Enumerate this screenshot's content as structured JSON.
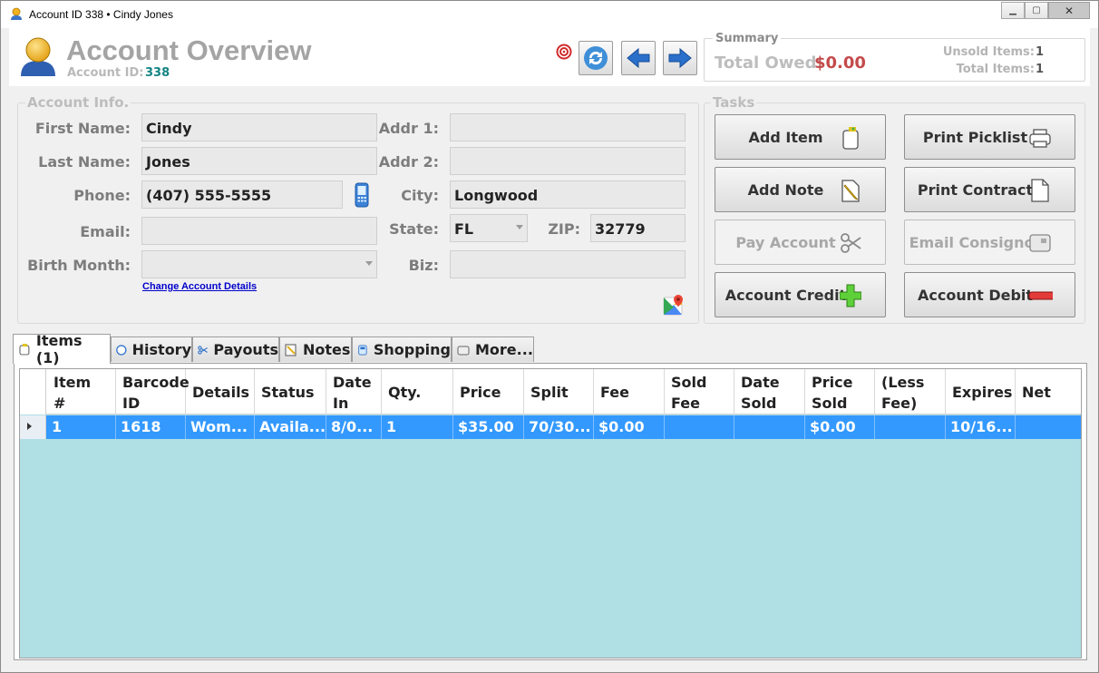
{
  "window": {
    "title": "Account ID 338 • Cindy Jones"
  },
  "header": {
    "title": "Account Overview",
    "account_id_label": "Account ID:",
    "account_id": "338"
  },
  "summary": {
    "legend": "Summary",
    "total_owed_label": "Total Owed:",
    "total_owed": "$0.00",
    "unsold_label": "Unsold Items:",
    "unsold": "1",
    "total_items_label": "Total Items:",
    "total_items": "1"
  },
  "account_info": {
    "legend": "Account Info.",
    "first_name_label": "First Name:",
    "first_name": "Cindy",
    "last_name_label": "Last Name:",
    "last_name": "Jones",
    "phone_label": "Phone:",
    "phone": "(407) 555-5555",
    "email_label": "Email:",
    "email": "",
    "birth_month_label": "Birth Month:",
    "birth_month": "",
    "addr1_label": "Addr 1:",
    "addr1": "",
    "addr2_label": "Addr 2:",
    "addr2": "",
    "city_label": "City:",
    "city": "Longwood",
    "state_label": "State:",
    "state": "FL",
    "zip_label": "ZIP:",
    "zip": "32779",
    "biz_label": "Biz:",
    "biz": "",
    "change_link": "Change Account Details"
  },
  "tasks": {
    "legend": "Tasks",
    "add_item": "Add Item",
    "print_picklist": "Print Picklist",
    "add_note": "Add Note",
    "print_contract": "Print Contract",
    "pay_account": "Pay Account",
    "email_consignor": "Email Consignor",
    "account_credit": "Account Credit",
    "account_debit": "Account Debit"
  },
  "tabs": [
    "Items (1)",
    "History",
    "Payouts",
    "Notes",
    "Shopping",
    "More..."
  ],
  "table": {
    "headers": [
      [
        "Item",
        "#"
      ],
      [
        "Barcode",
        "ID"
      ],
      [
        "Details",
        ""
      ],
      [
        "Status",
        ""
      ],
      [
        "Date",
        "In"
      ],
      [
        "Qty.",
        ""
      ],
      [
        "Price",
        ""
      ],
      [
        "Split",
        ""
      ],
      [
        "Fee",
        ""
      ],
      [
        "Sold",
        "Fee"
      ],
      [
        "Date",
        "Sold"
      ],
      [
        "Price",
        "Sold"
      ],
      [
        "(Less",
        "Fee)"
      ],
      [
        "Expires",
        ""
      ],
      [
        "Net",
        ""
      ]
    ],
    "rows": [
      [
        "1",
        "1618",
        "Wom...",
        "Availa...",
        "8/0...",
        "1",
        "$35.00",
        "70/30...",
        "$0.00",
        "",
        "",
        "$0.00",
        "",
        "10/16...",
        ""
      ]
    ]
  },
  "colors": {
    "accent": "#3399ff",
    "grid_bg": "#b0dfe4",
    "owed": "#c44b4b",
    "id": "#138484"
  }
}
